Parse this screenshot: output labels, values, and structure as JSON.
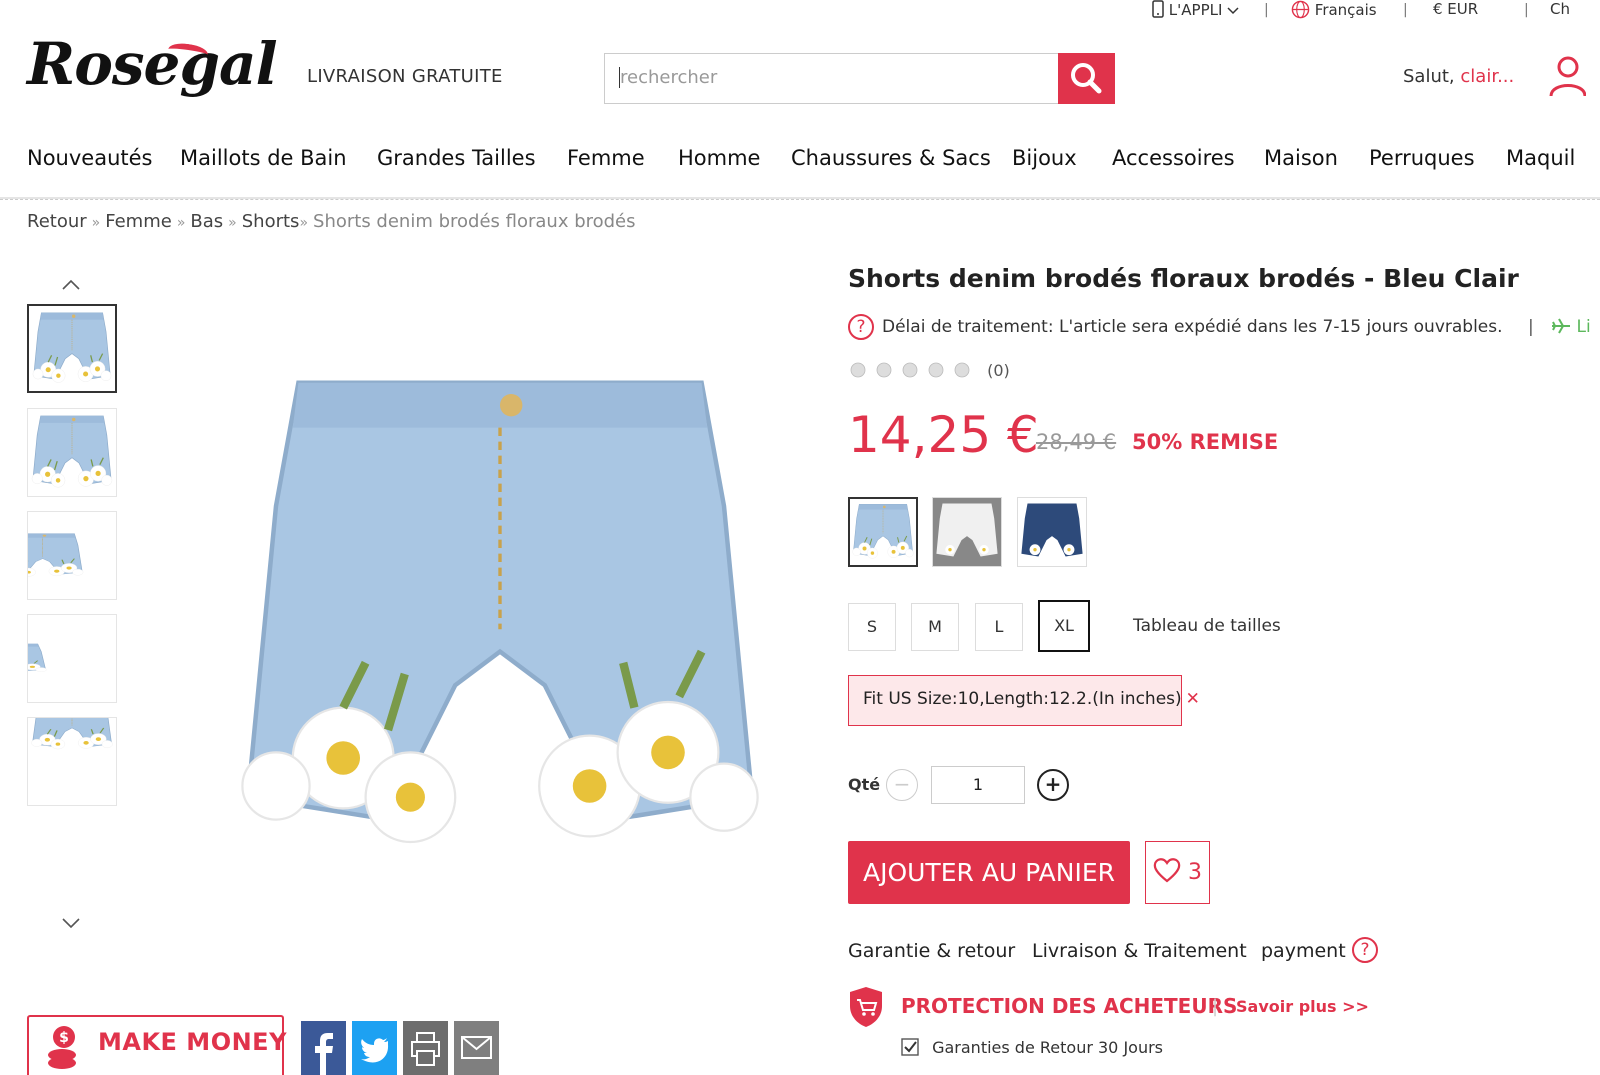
{
  "topbar": {
    "app": "L'APPLI",
    "language": "Français",
    "currency": "€ EUR",
    "cut": "Ch",
    "separator": "|"
  },
  "header": {
    "logo": "Rosegal",
    "free_shipping": "LIVRAISON GRATUITE",
    "search_placeholder": "rechercher",
    "greeting": "Salut,",
    "user_name": "clair...",
    "accent_color": "#e0334b"
  },
  "nav": {
    "items": [
      "Nouveautés",
      "Maillots de Bain",
      "Grandes Tailles",
      "Femme",
      "Homme",
      "Chaussures & Sacs",
      "Bijoux",
      "Accessoires",
      "Maison",
      "Perruques",
      "Maquil"
    ]
  },
  "breadcrumb": {
    "items": [
      "Retour",
      "Femme",
      "Bas",
      "Shorts"
    ],
    "current": "Shorts denim brodés floraux brodés",
    "separator": "»"
  },
  "product": {
    "title": "Shorts denim brodés floraux brodés - Bleu Clair",
    "delay_info": "Délai de traitement: L'article sera expédié dans les 7-15 jours ouvrables.",
    "delay_sep": "|",
    "delay_extra": "Li",
    "help_glyph": "?",
    "rating_count": "(0)",
    "price": "14,25 €",
    "old_price": "28,49 €",
    "discount": "50% REMISE",
    "colors": [
      "Bleu Clair",
      "Blanc",
      "Bleu Foncé"
    ],
    "sizes": [
      "S",
      "M",
      "L",
      "XL"
    ],
    "selected_size": "XL",
    "size_chart": "Tableau de tailles",
    "fit_info": "Fit US Size:10,Length:12.2.(In inches)",
    "close_glyph": "✕",
    "qty_label": "Qté",
    "qty_minus": "−",
    "qty_plus": "+",
    "qty_value": "1",
    "add_to_cart": "AJOUTER AU PANIER",
    "wishlist_count": "3",
    "info_tabs": [
      "Garantie & retour",
      "Livraison & Traitement",
      "payment"
    ],
    "protection_title": "PROTECTION DES ACHETEURS",
    "protection_sep": "|",
    "learn_more": "Savoir plus >>",
    "guarantee": "Garanties de Retour 30 Jours"
  },
  "sidebar": {
    "make_money": "MAKE MONEY"
  },
  "share": {
    "icons": [
      "facebook-icon",
      "twitter-icon",
      "print-icon",
      "email-icon"
    ]
  }
}
